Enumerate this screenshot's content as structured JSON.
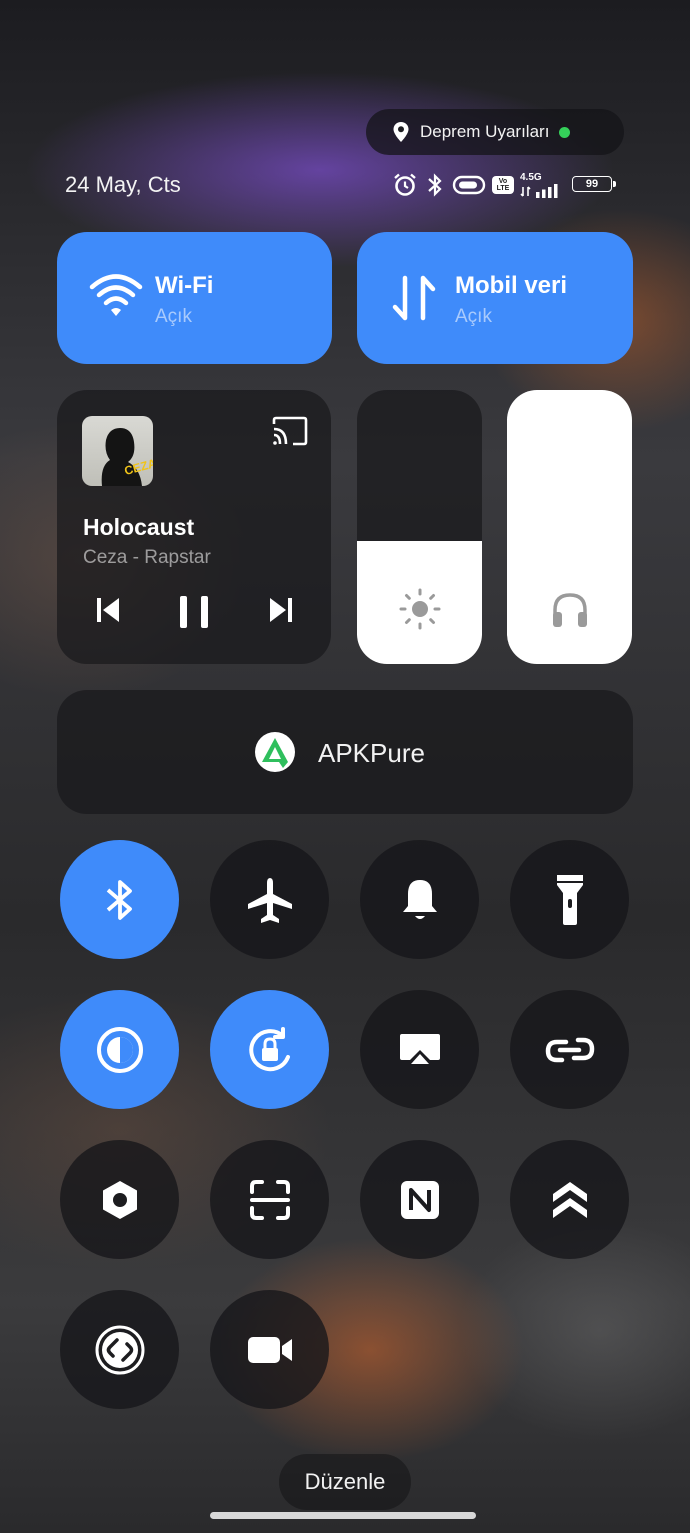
{
  "earthquake_pill": {
    "label": "Deprem Uyarıları",
    "status_color": "#35d05a"
  },
  "status_bar": {
    "date": "24 May, Cts",
    "icons": [
      "alarm-icon",
      "bluetooth-icon",
      "battery-saver-icon",
      "volte-icon",
      "signal-icon"
    ],
    "volte_label": "Vo LTE",
    "network_label": "4.5G",
    "battery_level": "99"
  },
  "tiles": {
    "wifi": {
      "label": "Wi-Fi",
      "state": "Açık",
      "icon": "wifi-icon"
    },
    "mobile_data": {
      "label": "Mobil veri",
      "state": "Açık",
      "icon": "data-transfer-icon"
    }
  },
  "media": {
    "title": "Holocaust",
    "artist": "Ceza - Rapstar",
    "album_art_text": "CEZA",
    "controls": [
      "previous-icon",
      "pause-icon",
      "next-icon"
    ],
    "cast_icon": "cast-icon"
  },
  "sliders": {
    "brightness": {
      "level": 0.45,
      "icon": "sun-icon"
    },
    "volume": {
      "level": 1.0,
      "icon": "headphones-icon"
    }
  },
  "app_shortcut": {
    "name": "APKPure",
    "icon": "apkpure-logo"
  },
  "toggles": [
    {
      "name": "bluetooth",
      "icon": "bluetooth-icon",
      "active": true
    },
    {
      "name": "airplane-mode",
      "icon": "airplane-icon",
      "active": false
    },
    {
      "name": "sound",
      "icon": "bell-icon",
      "active": false
    },
    {
      "name": "flashlight",
      "icon": "flashlight-icon",
      "active": false
    },
    {
      "name": "dark-mode",
      "icon": "contrast-icon",
      "active": true
    },
    {
      "name": "rotation-lock",
      "icon": "rotation-lock-icon",
      "active": true
    },
    {
      "name": "screen-cast",
      "icon": "screen-mirror-icon",
      "active": false
    },
    {
      "name": "link",
      "icon": "link-icon",
      "active": false
    },
    {
      "name": "settings",
      "icon": "hexagon-icon",
      "active": false
    },
    {
      "name": "scanner",
      "icon": "scan-icon",
      "active": false
    },
    {
      "name": "nfc",
      "icon": "nfc-icon",
      "active": false
    },
    {
      "name": "performance",
      "icon": "double-chevron-up-icon",
      "active": false
    },
    {
      "name": "shazam",
      "icon": "shazam-icon",
      "active": false
    },
    {
      "name": "screen-record",
      "icon": "video-camera-icon",
      "active": false
    }
  ],
  "colors": {
    "accent": "#3f8bfa",
    "tile_dark": "#19191c"
  },
  "edit_button": {
    "label": "Düzenle"
  }
}
